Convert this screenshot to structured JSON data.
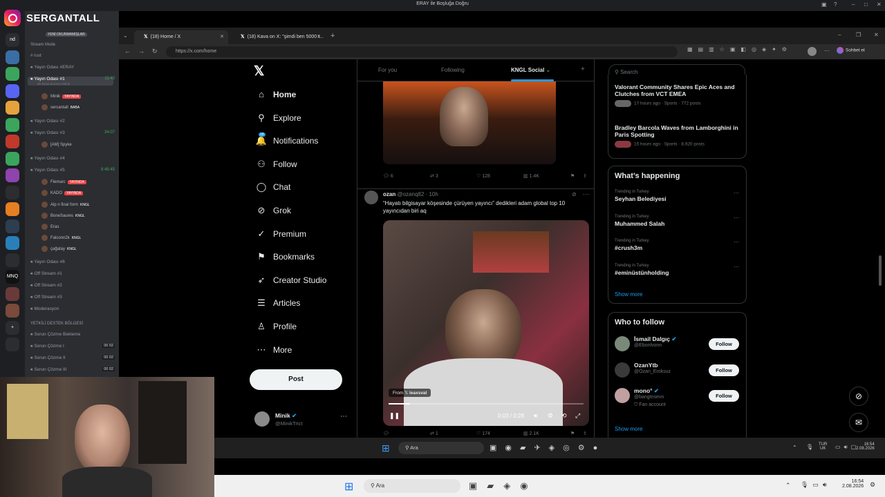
{
  "os": {
    "window_title": "ERAY ile Boşluğa Doğru"
  },
  "overlay": {
    "brand": "SERGANTALL"
  },
  "discord": {
    "servers": [
      "nd",
      "",
      "",
      "",
      "",
      "",
      "",
      "",
      "",
      "",
      "",
      "",
      "",
      "",
      "MNQ",
      "",
      "",
      "+",
      ""
    ],
    "channels": [
      {
        "label": "YENİ OKUNMAMIŞLAR",
        "kind": "badge"
      },
      {
        "label": "Stream Mode",
        "kind": "category"
      },
      {
        "label": "rust",
        "kind": "text"
      },
      {
        "label": "Yayın Odası #ERAY",
        "kind": "voice"
      },
      {
        "label": "Yayın Odası #1",
        "kind": "voice",
        "time": "11:40",
        "sub": "Bir kanal durumu belirle"
      },
      {
        "label": "Minik",
        "kind": "user",
        "tag": "YAYINDA"
      },
      {
        "label": "sercantall",
        "kind": "user",
        "tag2": "BABA"
      },
      {
        "label": "Yayın Odası #2",
        "kind": "voice"
      },
      {
        "label": "Yayın Odası #3",
        "kind": "voice",
        "time": "34:07"
      },
      {
        "label": "[AM] Spyke",
        "kind": "user"
      },
      {
        "label": "Yayın Odası #4",
        "kind": "voice"
      },
      {
        "label": "Yayın Odası #5",
        "kind": "voice",
        "time": "8:48:45"
      },
      {
        "label": "Flemarc",
        "kind": "user",
        "tag": "YAYINDA"
      },
      {
        "label": "KADO",
        "kind": "user",
        "tag": "YAYINDA"
      },
      {
        "label": "Alp n final form",
        "kind": "user",
        "tag2": "KNGL"
      },
      {
        "label": "BoneSaures",
        "kind": "user",
        "tag2": "KNGL"
      },
      {
        "label": "Eras",
        "kind": "user"
      },
      {
        "label": "Falconn2k",
        "kind": "user",
        "tag2": "KNGL"
      },
      {
        "label": "çağatay",
        "kind": "user",
        "tag2": "KNGL"
      },
      {
        "label": "Yayın Odası #6",
        "kind": "voice"
      },
      {
        "label": "Off Stream #1",
        "kind": "voice"
      },
      {
        "label": "Off Stream #2",
        "kind": "voice"
      },
      {
        "label": "Off Stream #3",
        "kind": "voice"
      },
      {
        "label": "Moderasyon",
        "kind": "voice"
      },
      {
        "label": "YETKİLİ DESTEK BÖLGESİ",
        "kind": "category"
      },
      {
        "label": "Sorun Çözme Bekleme",
        "kind": "voice"
      },
      {
        "label": "Sorun Çözme I",
        "kind": "voice",
        "count": "00 02"
      },
      {
        "label": "Sorun Çözme II",
        "kind": "voice",
        "count": "00 02"
      },
      {
        "label": "Sorun Çözme III",
        "kind": "voice",
        "count": "00 02"
      }
    ]
  },
  "browser": {
    "tabs": [
      {
        "label": "(18) Home / X",
        "active": true
      },
      {
        "label": "(18) Kava on X: \"şimdi ben 5000 t...",
        "active": false
      }
    ],
    "url": "https://x.com/home",
    "profile_button": "Sohbet et"
  },
  "x": {
    "nav": [
      {
        "label": "Home",
        "icon": "home-icon",
        "glyph": "⌂"
      },
      {
        "label": "Explore",
        "icon": "search-icon",
        "glyph": "⚲"
      },
      {
        "label": "Notifications",
        "icon": "bell-icon",
        "glyph": "🔔",
        "badge": "18"
      },
      {
        "label": "Follow",
        "icon": "follow-icon",
        "glyph": "⚇"
      },
      {
        "label": "Chat",
        "icon": "chat-icon",
        "glyph": "◯"
      },
      {
        "label": "Grok",
        "icon": "grok-icon",
        "glyph": "⊘"
      },
      {
        "label": "Premium",
        "icon": "premium-icon",
        "glyph": "✓"
      },
      {
        "label": "Bookmarks",
        "icon": "bookmark-icon",
        "glyph": "⚑"
      },
      {
        "label": "Creator Studio",
        "icon": "rocket-icon",
        "glyph": "➶"
      },
      {
        "label": "Articles",
        "icon": "articles-icon",
        "glyph": "☰"
      },
      {
        "label": "Profile",
        "icon": "profile-icon",
        "glyph": "♙"
      },
      {
        "label": "More",
        "icon": "more-icon",
        "glyph": "⋯"
      }
    ],
    "post_label": "Post",
    "account": {
      "name": "Minik",
      "handle": "@MinikTrict"
    },
    "feed_tabs": [
      "For you",
      "Following",
      "KNGL Social"
    ],
    "top_post_actions": {
      "replies": "6",
      "reposts": "3",
      "likes": "128",
      "views": "1.4K"
    },
    "post": {
      "author": "ozan",
      "handle": "@ozanq82",
      "time": "10h",
      "text": "“Hayatı bilgisayar köşesinde çürüyen yayıncı” dedikleri adam global top 10 yayıncıdan biri aq",
      "video_source": "leaxsval",
      "from_label": "From",
      "video_time": "0:03 / 0:28",
      "progress": 0.11,
      "actions": {
        "replies": "",
        "reposts": "1",
        "likes": "174",
        "views": "2.1K"
      }
    },
    "search_placeholder": "Search",
    "news": [
      {
        "title": "Valorant Community Shares Epic Aces and Clutches from VCT EMEA",
        "meta": "17 hours ago · Sports · 772 posts"
      },
      {
        "title": "Bradley Barcola Waves from Lamborghini in Paris Spotting",
        "meta": "15 hours ago · Sports · 8,920 posts"
      }
    ],
    "happening_title": "What’s happening",
    "trends": [
      {
        "context": "Trending in Turkey",
        "name": "Seyhan Belediyesi"
      },
      {
        "context": "Trending in Turkey",
        "name": "Muhammed Salah"
      },
      {
        "context": "Trending in Turkey",
        "name": "#crush3m"
      },
      {
        "context": "Trending in Turkey",
        "name": "#eminüstünholding"
      }
    ],
    "show_more": "Show more",
    "who_title": "Who to follow",
    "who": [
      {
        "name": "İsmail Dalgıç",
        "handle": "@Ebonlvonn",
        "verified": true,
        "extra": ""
      },
      {
        "name": "OzanYtb",
        "handle": "@Ozan_Eroksuz",
        "verified": false,
        "extra": ""
      },
      {
        "name": "mono°",
        "handle": "@bangtnsevn",
        "verified": true,
        "extra": "Fan account"
      }
    ],
    "follow_label": "Follow"
  },
  "taskbar_inner": {
    "search": "Ara",
    "lang": "TUR",
    "lang2": "UK",
    "time": "16:54",
    "date": "2.08.2026"
  },
  "taskbar_outer": {
    "search": "Ara",
    "time": "16:54",
    "date": "2.08.2026"
  },
  "colors": {
    "accent": "#1d9bf0",
    "discord_green": "#3ba55d",
    "live_red": "#ed4245"
  }
}
